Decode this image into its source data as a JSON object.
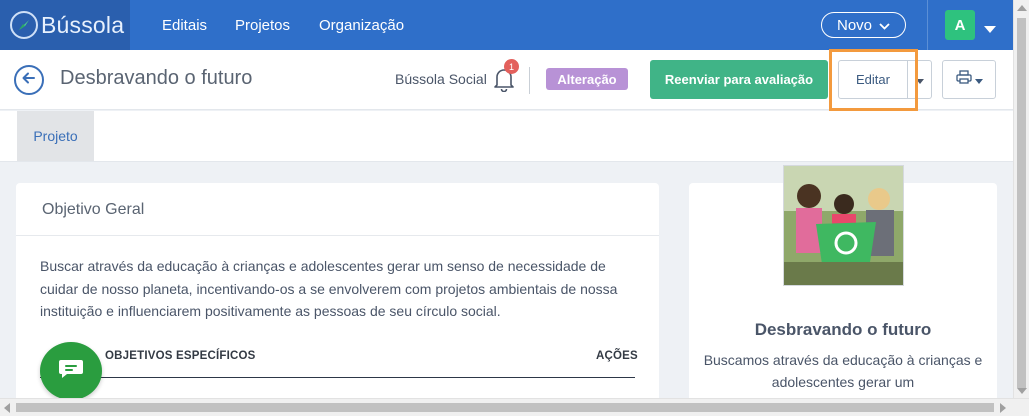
{
  "topbar": {
    "logo_text": "Bússola",
    "nav": [
      {
        "label": "Editais"
      },
      {
        "label": "Projetos"
      },
      {
        "label": "Organização"
      }
    ],
    "new_button": "Novo",
    "user_initial": "A",
    "colors": {
      "bar": "#2f6fc9",
      "logo_area": "#2a5fae",
      "avatar": "#2ec27e"
    }
  },
  "header": {
    "page_title": "Desbravando o futuro",
    "organization": "Bússola Social",
    "notification_count": "1",
    "status_badge": "Alteração",
    "resend_button": "Reenviar para avaliação",
    "edit_button": "Editar",
    "colors": {
      "status": "#b892d6",
      "resend": "#40b487",
      "highlight": "#f39a3e"
    }
  },
  "tabs": [
    {
      "label": "Projeto",
      "active": true
    }
  ],
  "objective": {
    "title": "Objetivo Geral",
    "text": "Buscar através da educação à crianças e adolescentes gerar um senso de necessidade de cuidar de nosso planeta, incentivando-os a se envolverem com projetos ambientais de nossa instituição e influenciarem positivamente as pessoas de seu círculo social.",
    "columns": {
      "specific": "OBJETIVOS ESPECÍFICOS",
      "actions": "AÇÕES"
    }
  },
  "project_card": {
    "title": "Desbravando o futuro",
    "description": "Buscamos através da educação à crianças e adolescentes gerar um"
  },
  "icons": [
    "compass-logo-icon",
    "chevron-down-icon",
    "caret-down-icon",
    "back-arrow-icon",
    "bell-icon",
    "printer-icon",
    "chat-icon"
  ]
}
